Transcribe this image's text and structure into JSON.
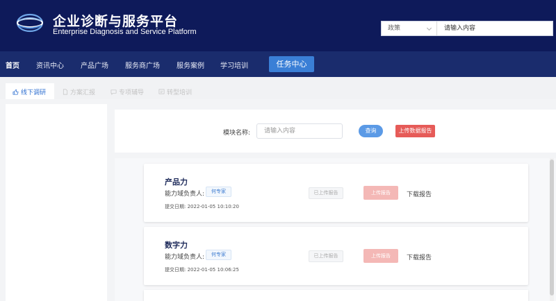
{
  "header": {
    "title_cn": "企业诊断与服务平台",
    "title_en": "Enterprise Diagnosis and Service Platform",
    "logo_icon": "globe-logo-icon"
  },
  "search": {
    "category": "政策",
    "value": "请输入内容"
  },
  "nav": {
    "items": [
      {
        "label": "首页"
      },
      {
        "label": "资讯中心"
      },
      {
        "label": "产品广场"
      },
      {
        "label": "服务商广场"
      },
      {
        "label": "服务案例"
      },
      {
        "label": "学习培训"
      },
      {
        "label": "任务中心"
      }
    ],
    "active_color": "#3a7fd6"
  },
  "subtabs": [
    {
      "label": "线下调研",
      "icon": "thumbs-up-icon"
    },
    {
      "label": "方案汇报",
      "icon": "document-icon"
    },
    {
      "label": "专项辅导",
      "icon": "chat-icon"
    },
    {
      "label": "转型培训",
      "icon": "training-icon"
    }
  ],
  "filter": {
    "label": "模块名称:",
    "placeholder": "请输入内容",
    "query_label": "查询",
    "upload_data_label": "上传数据报告"
  },
  "cards": [
    {
      "title": "产品力",
      "owner_label": "能力域负责人:",
      "expert_tag": "何专家",
      "date": "提交日期: 2022-01-05 10:10:20",
      "uploaded_label": "已上传报告",
      "upload_label": "上传报告",
      "download_label": "下载报告"
    },
    {
      "title": "数字力",
      "owner_label": "能力域负责人:",
      "expert_tag": "何专家",
      "date": "提交日期: 2022-01-05 10:06:25",
      "uploaded_label": "已上传报告",
      "upload_label": "上传报告",
      "download_label": "下载报告"
    }
  ],
  "colors": {
    "header_bg": "#0e1a5a",
    "nav_bg": "#1a2c6d",
    "primary": "#3a7fd6",
    "danger": "#e65b58",
    "danger_light": "#f4b8b6"
  }
}
